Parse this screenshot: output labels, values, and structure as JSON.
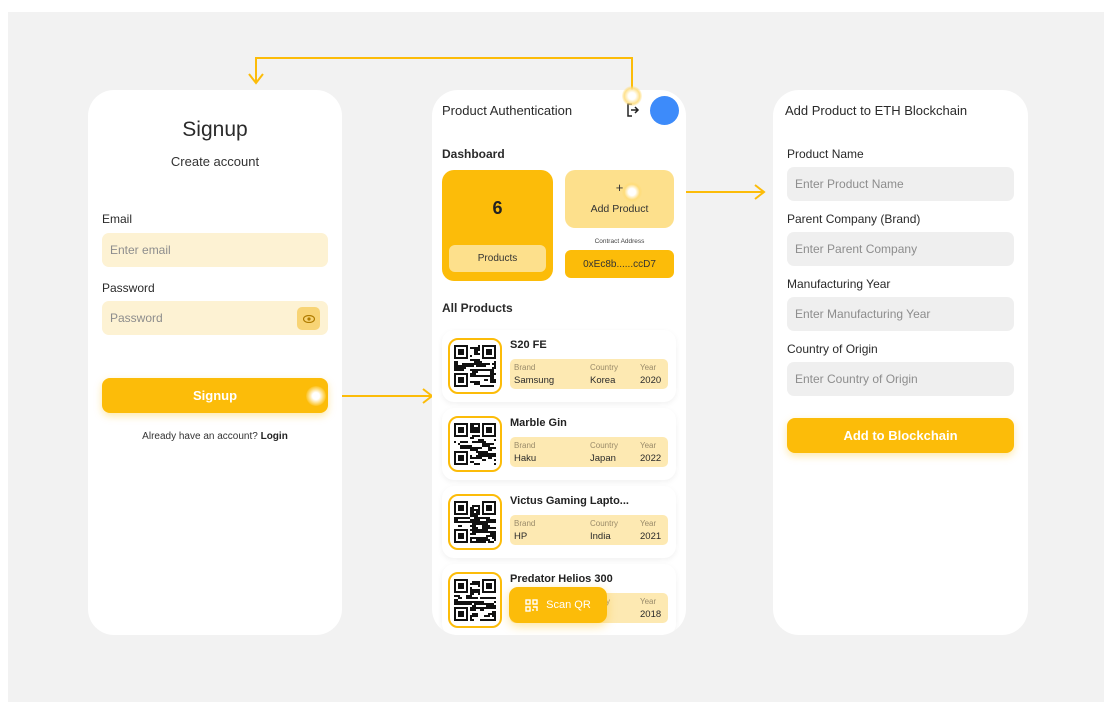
{
  "signup": {
    "title": "Signup",
    "subtitle": "Create account",
    "email_label": "Email",
    "email_placeholder": "Enter email",
    "password_label": "Password",
    "password_placeholder": "Password",
    "button": "Signup",
    "login_prompt": "Already have an account?",
    "login_link": "Login"
  },
  "dashboard": {
    "header_title": "Product Authentication",
    "section_title": "Dashboard",
    "product_count": "6",
    "products_label": "Products",
    "add_plus": "+",
    "add_label": "Add Product",
    "contract_label": "Contract Address",
    "contract_value": "0xEc8b......ccD7",
    "all_products_title": "All Products",
    "meta_labels": {
      "brand": "Brand",
      "country": "Country",
      "year": "Year"
    },
    "products": [
      {
        "name": "S20 FE",
        "brand": "Samsung",
        "country": "Korea",
        "year": "2020"
      },
      {
        "name": "Marble Gin",
        "brand": "Haku",
        "country": "Japan",
        "year": "2022"
      },
      {
        "name": "Victus Gaming Lapto...",
        "brand": "HP",
        "country": "India",
        "year": "2021"
      },
      {
        "name": "Predator Helios 300",
        "brand": "",
        "country": "...ntry",
        "year": "2018"
      }
    ],
    "scan_button": "Scan QR"
  },
  "add_product": {
    "title": "Add Product to ETH Blockchain",
    "fields": [
      {
        "label": "Product Name",
        "placeholder": "Enter Product Name"
      },
      {
        "label": "Parent Company (Brand)",
        "placeholder": "Enter Parent Company"
      },
      {
        "label": "Manufacturing Year",
        "placeholder": "Enter Manufacturing Year"
      },
      {
        "label": "Country of Origin",
        "placeholder": "Enter Country of Origin"
      }
    ],
    "button": "Add to Blockchain"
  },
  "colors": {
    "accent": "#fcbc09",
    "accent_light": "#fde08c",
    "field_yellow": "#fdf2d3",
    "field_grey": "#efefef",
    "avatar": "#3d8bfa",
    "background": "#f2f2f2"
  }
}
